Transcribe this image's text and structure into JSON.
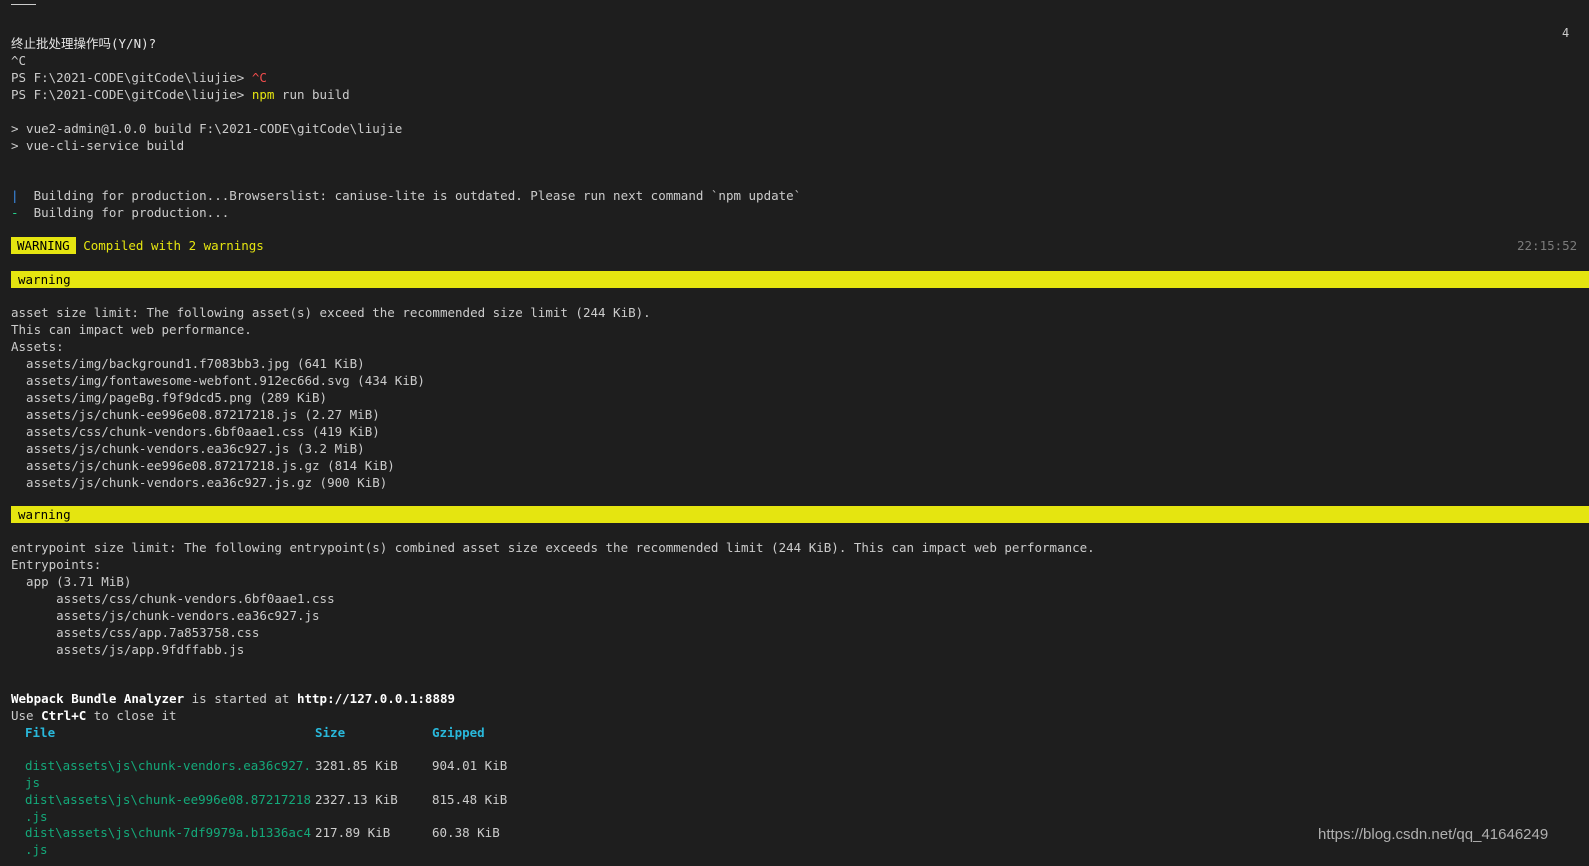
{
  "header": {
    "edge_glyph": "4"
  },
  "lines": {
    "prompt_terminate": "终止批处理操作吗(Y/N)?",
    "ctrl_c": "^C",
    "ps1_prompt": "PS F:\\2021-CODE\\gitCode\\liujie> ",
    "ps1_cmd": "^C",
    "ps2_prompt": "PS F:\\2021-CODE\\gitCode\\liujie> ",
    "ps2_npm": "npm",
    "ps2_rest": " run build",
    "script1": "> vue2-admin@1.0.0 build F:\\2021-CODE\\gitCode\\liujie",
    "script2": "> vue-cli-service build",
    "building1_spinner": "|",
    "building1_text": "  Building for production...Browserslist: caniuse-lite is outdated. Please run next command `npm update`",
    "building2_spinner": "-",
    "building2_text": "  Building for production..."
  },
  "compile": {
    "badge": "WARNING",
    "message": "Compiled with 2 warnings",
    "timestamp": "22:15:52"
  },
  "warning1": {
    "label": "warning",
    "line1": "asset size limit: The following asset(s) exceed the recommended size limit (244 KiB).",
    "line2": "This can impact web performance.",
    "assets_header": "Assets:",
    "assets": [
      "  assets/img/background1.f7083bb3.jpg (641 KiB)",
      "  assets/img/fontawesome-webfont.912ec66d.svg (434 KiB)",
      "  assets/img/pageBg.f9f9dcd5.png (289 KiB)",
      "  assets/js/chunk-ee996e08.87217218.js (2.27 MiB)",
      "  assets/css/chunk-vendors.6bf0aae1.css (419 KiB)",
      "  assets/js/chunk-vendors.ea36c927.js (3.2 MiB)",
      "  assets/js/chunk-ee996e08.87217218.js.gz (814 KiB)",
      "  assets/js/chunk-vendors.ea36c927.js.gz (900 KiB)"
    ]
  },
  "warning2": {
    "label": "warning",
    "line1": "entrypoint size limit: The following entrypoint(s) combined asset size exceeds the recommended limit (244 KiB). This can impact web performance.",
    "entry_header": "Entrypoints:",
    "app_line": "  app (3.71 MiB)",
    "entries": [
      "      assets/css/chunk-vendors.6bf0aae1.css",
      "      assets/js/chunk-vendors.ea36c927.js",
      "      assets/css/app.7a853758.css",
      "      assets/js/app.9fdffabb.js"
    ]
  },
  "analyzer": {
    "name": "Webpack Bundle Analyzer",
    "middle": " is started at ",
    "url": "http://127.0.0.1:8889",
    "use": "Use ",
    "keys": "Ctrl+C",
    "close": " to close it"
  },
  "table": {
    "headers": {
      "file": "File",
      "size": "Size",
      "gzipped": "Gzipped"
    },
    "rows": [
      {
        "file1": "dist\\assets\\js\\chunk-vendors.ea36c927.",
        "file2": "js",
        "size": "3281.85 KiB",
        "gzip": "904.01 KiB"
      },
      {
        "file1": "dist\\assets\\js\\chunk-ee996e08.87217218",
        "file2": ".js",
        "size": "2327.13 KiB",
        "gzip": "815.48 KiB"
      },
      {
        "file1": "dist\\assets\\js\\chunk-7df9979a.b1336ac4",
        "file2": ".js",
        "size": "217.89 KiB",
        "gzip": "60.38 KiB"
      }
    ]
  },
  "watermark": "https://blog.csdn.net/qq_41646249",
  "colors": {
    "background": "#1e1e1e",
    "foreground": "#cccccc",
    "warning_yellow": "#e5e510",
    "error_red": "#f14c4c",
    "header_cyan": "#29b8db",
    "file_green": "#14a97a"
  }
}
